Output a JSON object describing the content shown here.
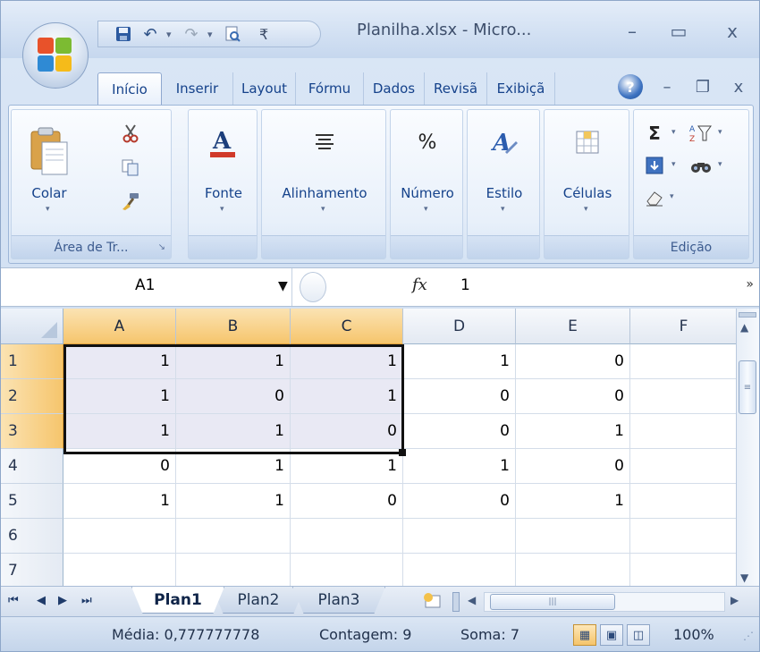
{
  "window": {
    "title": "Planilha.xlsx - Micro...",
    "quick_access": {
      "save_icon": "save-icon",
      "undo_icon": "undo-icon",
      "redo_icon": "redo-icon",
      "print_preview_icon": "print-preview-icon",
      "customize_icon": "customize-qat-icon"
    },
    "controls": {
      "minimize": "–",
      "maximize": "▭",
      "close": "x"
    },
    "doc_controls": {
      "minimize": "–",
      "restore": "❐",
      "close": "x"
    }
  },
  "ribbon": {
    "tabs": [
      {
        "label": "Início",
        "active": true
      },
      {
        "label": "Inserir"
      },
      {
        "label": "Layout"
      },
      {
        "label": "Fórmu"
      },
      {
        "label": "Dados"
      },
      {
        "label": "Revisã"
      },
      {
        "label": "Exibiçã"
      }
    ],
    "help_label": "?",
    "groups": {
      "clipboard": {
        "label": "Área de Tr...",
        "paste_label": "Colar"
      },
      "font": {
        "label": "Fonte"
      },
      "alignment": {
        "label": "Alinhamento"
      },
      "number": {
        "label": "Número",
        "icon_text": "%"
      },
      "style": {
        "label": "Estilo"
      },
      "cells": {
        "label": "Células"
      },
      "editing": {
        "label": "Edição",
        "sum_icon": "Σ"
      }
    }
  },
  "formula_bar": {
    "name_box": "A1",
    "fx_label": "fx",
    "formula": "1"
  },
  "grid": {
    "columns": [
      "A",
      "B",
      "C",
      "D",
      "E",
      "F"
    ],
    "selected_columns": [
      "A",
      "B",
      "C"
    ],
    "rows": [
      {
        "num": "1",
        "cells": [
          "1",
          "1",
          "1",
          "1",
          "0",
          ""
        ]
      },
      {
        "num": "2",
        "cells": [
          "1",
          "0",
          "1",
          "0",
          "0",
          ""
        ]
      },
      {
        "num": "3",
        "cells": [
          "1",
          "1",
          "0",
          "0",
          "1",
          ""
        ]
      },
      {
        "num": "4",
        "cells": [
          "0",
          "1",
          "1",
          "1",
          "0",
          ""
        ]
      },
      {
        "num": "5",
        "cells": [
          "1",
          "1",
          "0",
          "0",
          "1",
          ""
        ]
      },
      {
        "num": "6",
        "cells": [
          "",
          "",
          "",
          "",
          "",
          ""
        ]
      },
      {
        "num": "7",
        "cells": [
          "",
          "",
          "",
          "",
          "",
          ""
        ]
      }
    ],
    "selected_rows": [
      "1",
      "2",
      "3"
    ]
  },
  "sheet_tabs": [
    {
      "label": "Plan1",
      "active": true
    },
    {
      "label": "Plan2"
    },
    {
      "label": "Plan3"
    }
  ],
  "status": {
    "average": "Média: 0,777777778",
    "count": "Contagem: 9",
    "sum": "Soma: 7",
    "zoom": "100%"
  }
}
